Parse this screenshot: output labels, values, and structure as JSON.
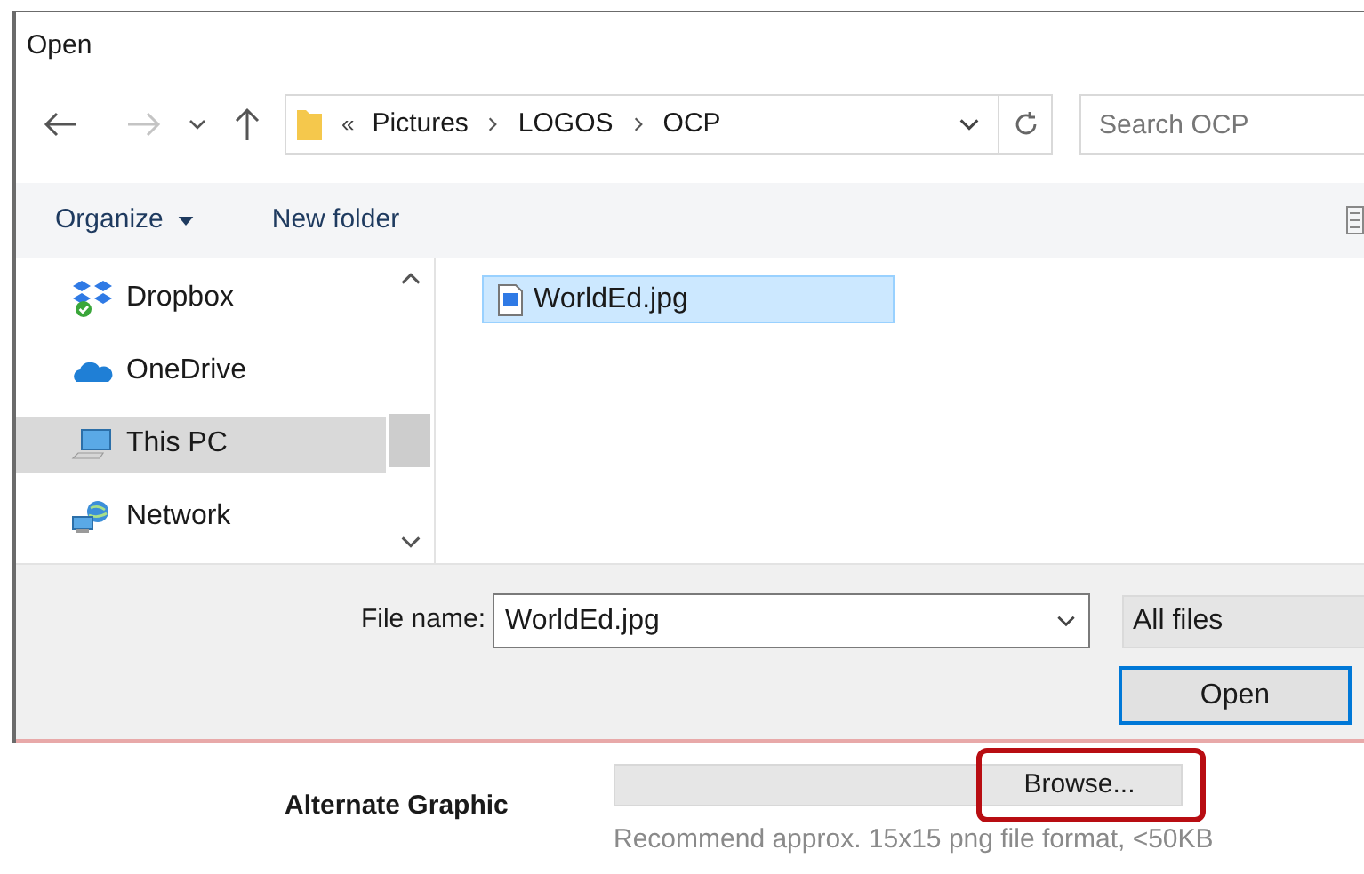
{
  "window": {
    "title": "Open"
  },
  "address_bar": {
    "overflow": "«",
    "path": [
      "Pictures",
      "LOGOS",
      "OCP"
    ]
  },
  "search": {
    "placeholder": "Search OCP"
  },
  "toolbar": {
    "organize": "Organize",
    "new_folder": "New folder"
  },
  "sidebar": {
    "items": [
      {
        "label": "Dropbox",
        "kind": "dropbox",
        "selected": false
      },
      {
        "label": "OneDrive",
        "kind": "cloud",
        "selected": false
      },
      {
        "label": "This PC",
        "kind": "computer",
        "selected": true
      },
      {
        "label": "Network",
        "kind": "network",
        "selected": false
      }
    ]
  },
  "files": [
    {
      "name": "WorldEd.jpg",
      "selected": true
    }
  ],
  "file_name": {
    "label": "File name:",
    "value": "WorldEd.jpg"
  },
  "file_type": {
    "value": "All files"
  },
  "buttons": [
    "Open"
  ],
  "page": {
    "label": "Alternate Graphic",
    "button": "Browse...",
    "highlighted": true,
    "hint": "Recommend approx. 15x15 png file format, <50KB"
  }
}
